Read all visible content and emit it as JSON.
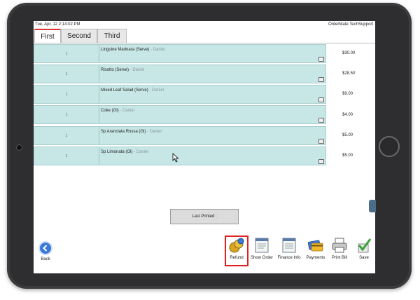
{
  "header": {
    "datetime": "Tue, Apr, 12 2:14:02 PM",
    "support": "OrderMate TechSupport"
  },
  "tabs": [
    {
      "label": "First",
      "active": true
    },
    {
      "label": "Second",
      "active": false
    },
    {
      "label": "Third",
      "active": false
    }
  ],
  "order_items": [
    {
      "qty": "1",
      "name": "Linguine Marinara (Serve)",
      "server": " - Daniel",
      "price": "$30.00"
    },
    {
      "qty": "1",
      "name": "Risotto (Serve)",
      "server": " - Daniel",
      "price": "$28.50"
    },
    {
      "qty": "1",
      "name": "Mixed Leaf Salad (Serve)",
      "server": " - Daniel",
      "price": "$9.00"
    },
    {
      "qty": "1",
      "name": "Coke (Gl)",
      "server": " - Daniel",
      "price": "$4.00"
    },
    {
      "qty": "1",
      "name": "Sp Aranciata Rossa (Gl)",
      "server": " - Daniel",
      "price": "$5.00"
    },
    {
      "qty": "1",
      "name": "Sp Limonata (Gl)",
      "server": " - Daniel",
      "price": "$5.00"
    }
  ],
  "last_printed_label": "Last Printed :",
  "toolbar": {
    "back": "Back",
    "refund": "Refund",
    "show_order": "Show Order",
    "finance_info": "Finance Info",
    "payments": "Payments",
    "print_bill": "Print Bill",
    "save": "Save"
  },
  "colors": {
    "row_bg": "#c7e6e6",
    "accent_red": "#e02020",
    "back_blue": "#3a78d8"
  }
}
